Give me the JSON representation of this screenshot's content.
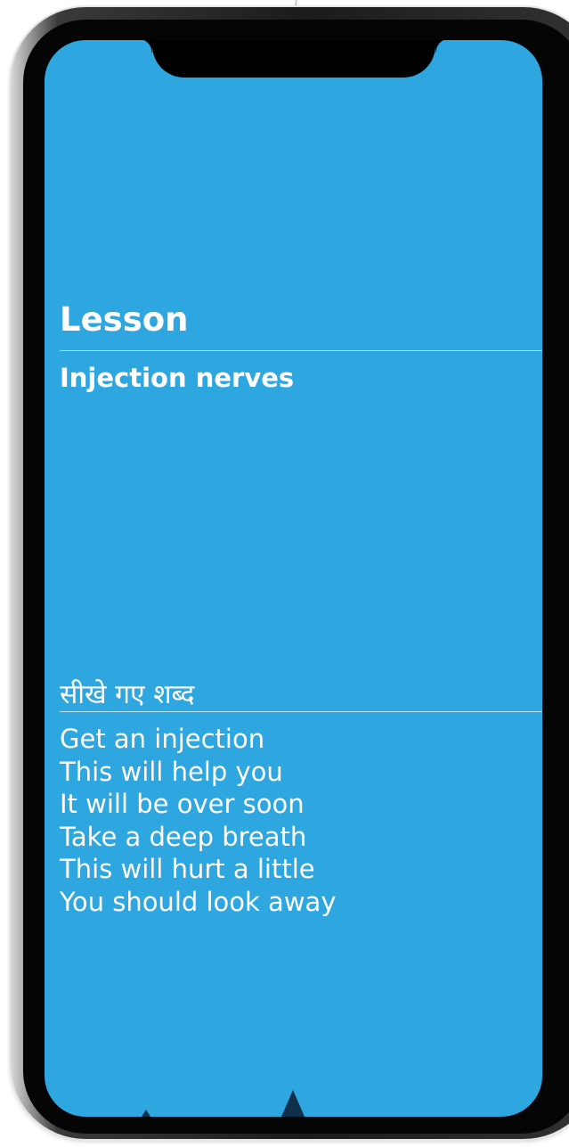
{
  "lesson": {
    "heading": "Lesson",
    "title": "Injection nerves"
  },
  "words": {
    "heading": "सीखे गए शब्द",
    "items": [
      "Get an injection",
      "This will help you",
      "It will be over soon",
      "Take a deep breath",
      "This will hurt a little",
      "You should look away"
    ]
  },
  "colors": {
    "screen_background": "#2ea6e0",
    "text": "#ffffff",
    "peak": "#0f2f4a"
  }
}
